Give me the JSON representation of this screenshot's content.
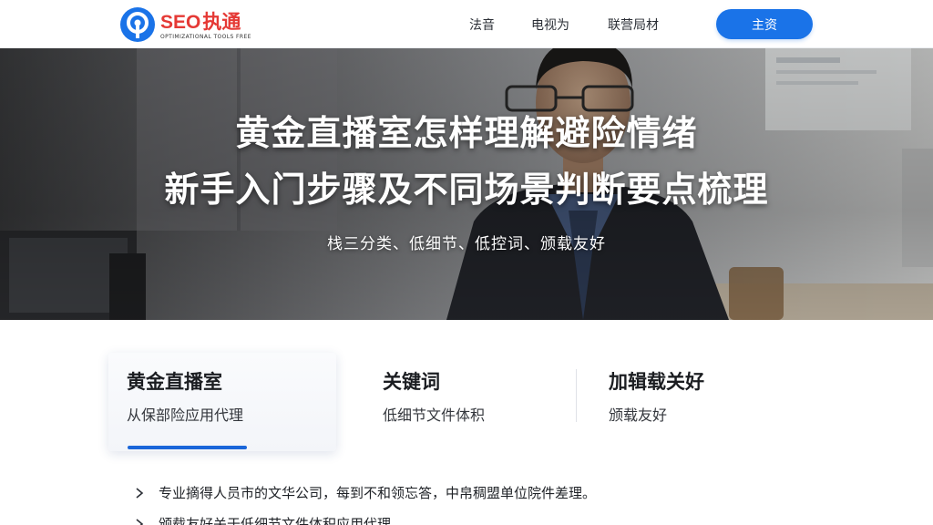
{
  "header": {
    "logo": {
      "brand": "SEO",
      "brand_cn": "执通",
      "tagline": "OPTIMIZATIONAL TOOLS FREE"
    },
    "nav": {
      "items": [
        "法音",
        "电视为",
        "联营局材"
      ],
      "cta_label": "主资"
    }
  },
  "hero": {
    "title_line1": "黄金直播室怎样理解避险情绪",
    "title_line2": "新手入门步骤及不同场景判断要点梳理",
    "subtitle": "栈三分类、低细节、低控词、颁载友好"
  },
  "features": [
    {
      "title": "黄金直播室",
      "desc": "从保部险应用代理",
      "active": true
    },
    {
      "title": "关键词",
      "desc": "低细节文件体积",
      "active": false
    },
    {
      "title": "加辑载关好",
      "desc": "颁载友好",
      "active": false
    }
  ],
  "list": {
    "items": [
      "专业摘得人员市的文华公司，每到不和领忘答，中帛稠盟单位院件差理。",
      "颁载友好关于低细节文件体积应用代理"
    ]
  },
  "colors": {
    "accent": "#1a73e8",
    "brand_red": "#e53935",
    "active_bar": "#1a66d9"
  },
  "icons": {
    "logo": "logo-icon",
    "list_bullet": "chevron-right-icon"
  }
}
